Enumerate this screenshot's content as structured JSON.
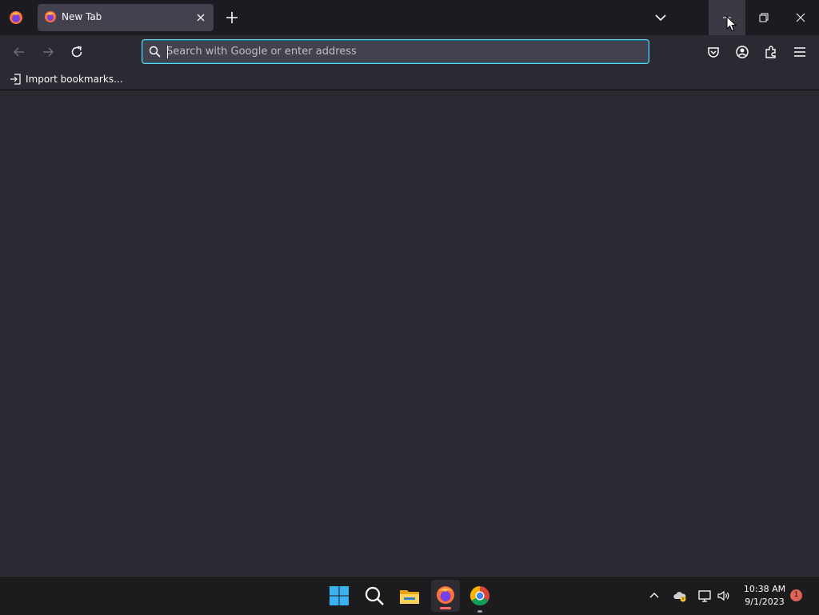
{
  "browser": {
    "tab": {
      "title": "New Tab"
    },
    "urlbar": {
      "placeholder": "Search with Google or enter address",
      "value": ""
    },
    "bookmarks": {
      "import_label": "Import bookmarks..."
    }
  },
  "taskbar": {
    "clock": {
      "time": "10:38 AM",
      "date": "9/1/2023"
    },
    "notification_count": "1",
    "pinned": [
      "windows-start-icon",
      "search-icon",
      "file-explorer-icon",
      "firefox-icon",
      "chrome-icon"
    ]
  },
  "colors": {
    "titlebar": "#1c1b22",
    "toolbar": "#2b2a33",
    "urlbar_bg": "#42414d",
    "urlbar_focus": "#6fd1e6",
    "taskbar": "#1c1c1f"
  }
}
